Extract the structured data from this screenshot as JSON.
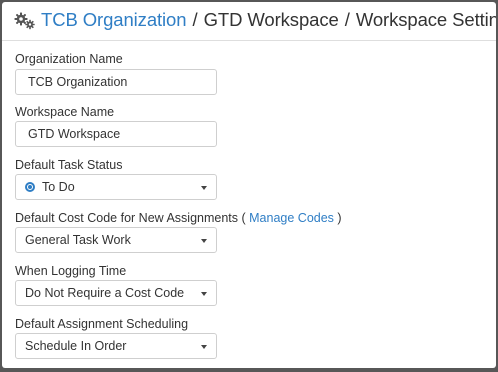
{
  "breadcrumb": {
    "organization": "TCB Organization",
    "separator": "/",
    "workspace": "GTD Workspace",
    "current": "Workspace Settings"
  },
  "icons": {
    "settings": "gears-icon",
    "status_marker": "status-dot-icon",
    "dropdown": "chevron-down-icon"
  },
  "colors": {
    "link": "#2f7ec5",
    "text": "#333333",
    "border": "#cfcfcf",
    "frame": "#575757"
  },
  "form": {
    "organization_name": {
      "label": "Organization Name",
      "value": "TCB Organization"
    },
    "workspace_name": {
      "label": "Workspace Name",
      "value": "GTD Workspace"
    },
    "default_task_status": {
      "label": "Default Task Status",
      "value": "To Do"
    },
    "default_cost_code": {
      "label_prefix": "Default Cost Code for New Assignments (",
      "manage_link": "Manage Codes",
      "label_suffix": ")",
      "value": "General Task Work"
    },
    "when_logging_time": {
      "label": "When Logging Time",
      "value": "Do Not Require a Cost Code"
    },
    "default_assignment_scheduling": {
      "label": "Default Assignment Scheduling",
      "value": "Schedule In Order"
    }
  }
}
